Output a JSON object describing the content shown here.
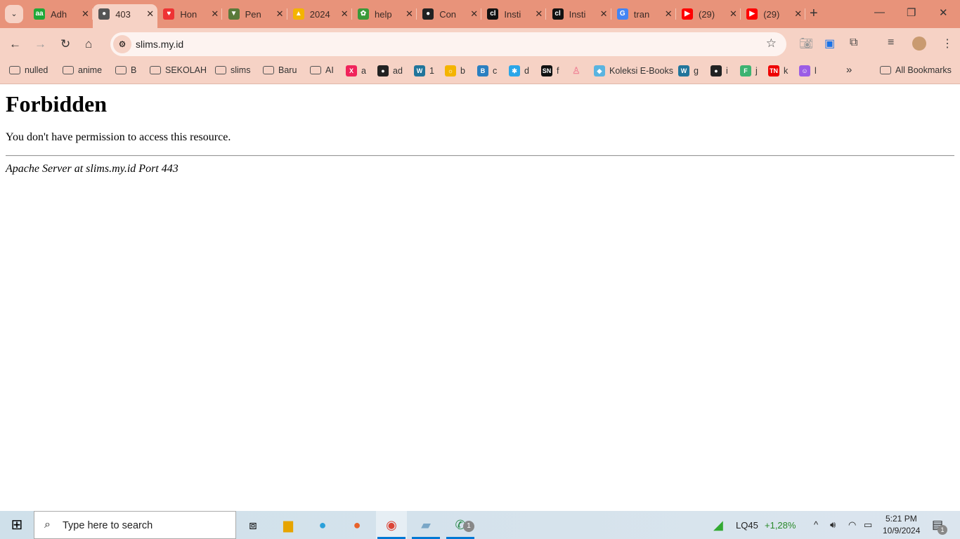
{
  "tabs": [
    {
      "label": "Adh",
      "icon": "aa-icon",
      "color": "#1fa838",
      "glyph": "aa"
    },
    {
      "label": "403",
      "icon": "globe-icon",
      "color": "#555",
      "glyph": "●",
      "active": true
    },
    {
      "label": "Hon",
      "icon": "heart-icon",
      "color": "#e33",
      "glyph": "♥"
    },
    {
      "label": "Pen",
      "icon": "school-emblem-icon",
      "color": "#5a7a3a",
      "glyph": "▼"
    },
    {
      "label": "2024",
      "icon": "google-drive-icon",
      "color": "#f4b400",
      "glyph": "▲"
    },
    {
      "label": "help",
      "icon": "leaf-icon",
      "color": "#3a9a3a",
      "glyph": "✿"
    },
    {
      "label": "Con",
      "icon": "github-icon",
      "color": "#222",
      "glyph": "●"
    },
    {
      "label": "Insti",
      "icon": "cl-icon",
      "color": "#111",
      "glyph": "cl"
    },
    {
      "label": "Insti",
      "icon": "cl-icon",
      "color": "#111",
      "glyph": "cl"
    },
    {
      "label": "tran",
      "icon": "google-icon",
      "color": "#4285f4",
      "glyph": "G"
    },
    {
      "label": "(29)",
      "icon": "youtube-icon",
      "color": "#f00",
      "glyph": "▶"
    },
    {
      "label": "(29)",
      "icon": "youtube-icon",
      "color": "#f00",
      "glyph": "▶"
    }
  ],
  "address": {
    "url": "slims.my.id"
  },
  "bookmarks": [
    {
      "label": "nulled",
      "folder": true
    },
    {
      "label": "anime",
      "folder": true
    },
    {
      "label": "B",
      "folder": true
    },
    {
      "label": "SEKOLAH",
      "folder": true
    },
    {
      "label": "slims",
      "folder": true
    },
    {
      "label": "Baru",
      "folder": true
    },
    {
      "label": "AI",
      "folder": true
    },
    {
      "label": "a",
      "color": "#f0245b",
      "glyph": "X"
    },
    {
      "label": "ad",
      "color": "#222",
      "glyph": "●"
    },
    {
      "label": "1",
      "color": "#21759b",
      "glyph": "W"
    },
    {
      "label": "b",
      "color": "#f4b400",
      "glyph": "☼"
    },
    {
      "label": "c",
      "color": "#2a7fc0",
      "glyph": "B"
    },
    {
      "label": "d",
      "color": "#2ba6e8",
      "glyph": "✱"
    },
    {
      "label": "f",
      "color": "#111",
      "glyph": "SN"
    },
    {
      "label": "",
      "color": "#f6d2c5",
      "glyph": "♙"
    },
    {
      "label": "Koleksi E-Books",
      "color": "#5ab4e0",
      "glyph": "◆"
    },
    {
      "label": "g",
      "color": "#21759b",
      "glyph": "W"
    },
    {
      "label": "i",
      "color": "#222",
      "glyph": "●"
    },
    {
      "label": "j",
      "color": "#3cb371",
      "glyph": "F"
    },
    {
      "label": "k",
      "color": "#e00",
      "glyph": "TN"
    },
    {
      "label": "l",
      "color": "#9b5de5",
      "glyph": "☺"
    }
  ],
  "all_bookmarks": "All Bookmarks",
  "page": {
    "title": "Forbidden",
    "message": "You don't have permission to access this resource.",
    "footer": "Apache Server at slims.my.id Port 443"
  },
  "taskbar": {
    "search_placeholder": "Type here to search",
    "stock_name": "LQ45",
    "stock_change": "+1,28%",
    "time": "5:21 PM",
    "date": "10/9/2024",
    "whatsapp_badge": "1",
    "notification_badge": "1"
  }
}
